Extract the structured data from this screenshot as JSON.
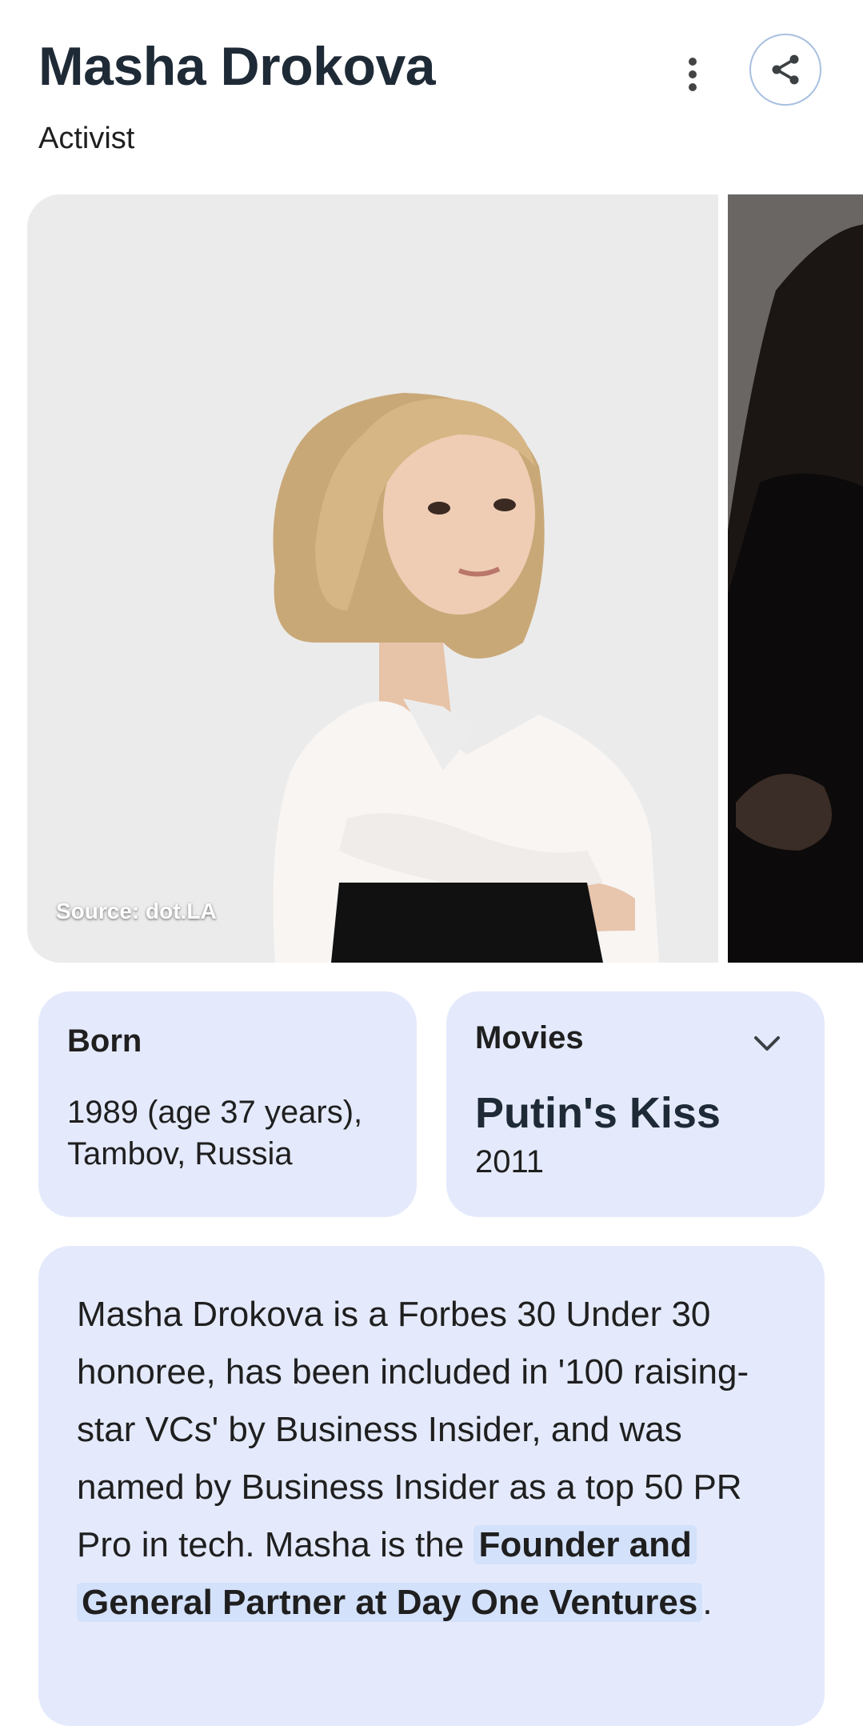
{
  "header": {
    "title": "Masha Drokova",
    "subtitle": "Activist",
    "more_icon": "more-vert-icon",
    "share_icon": "share-icon"
  },
  "gallery": {
    "source": "Source: dot.LA"
  },
  "born": {
    "label": "Born",
    "value_line1": "1989 (age 37 years),",
    "value_line2": "Tambov, Russia"
  },
  "movies": {
    "label": "Movies",
    "title": "Putin's Kiss",
    "year": "2011",
    "expand_icon": "chevron-down-icon"
  },
  "description": {
    "text": "Masha Drokova is a Forbes 30 Under 30 honoree, has been included in '100 raising-star VCs' by Business Insider, and was named by Business Insider as a top 50 PR Pro in tech. Masha is the ",
    "highlight": "Founder and General Partner at Day One Ventures",
    "end": "."
  },
  "colors": {
    "card_bg": "#e4eafc",
    "highlight_bg": "#d3e1fb",
    "share_border": "#a8c0e0"
  }
}
